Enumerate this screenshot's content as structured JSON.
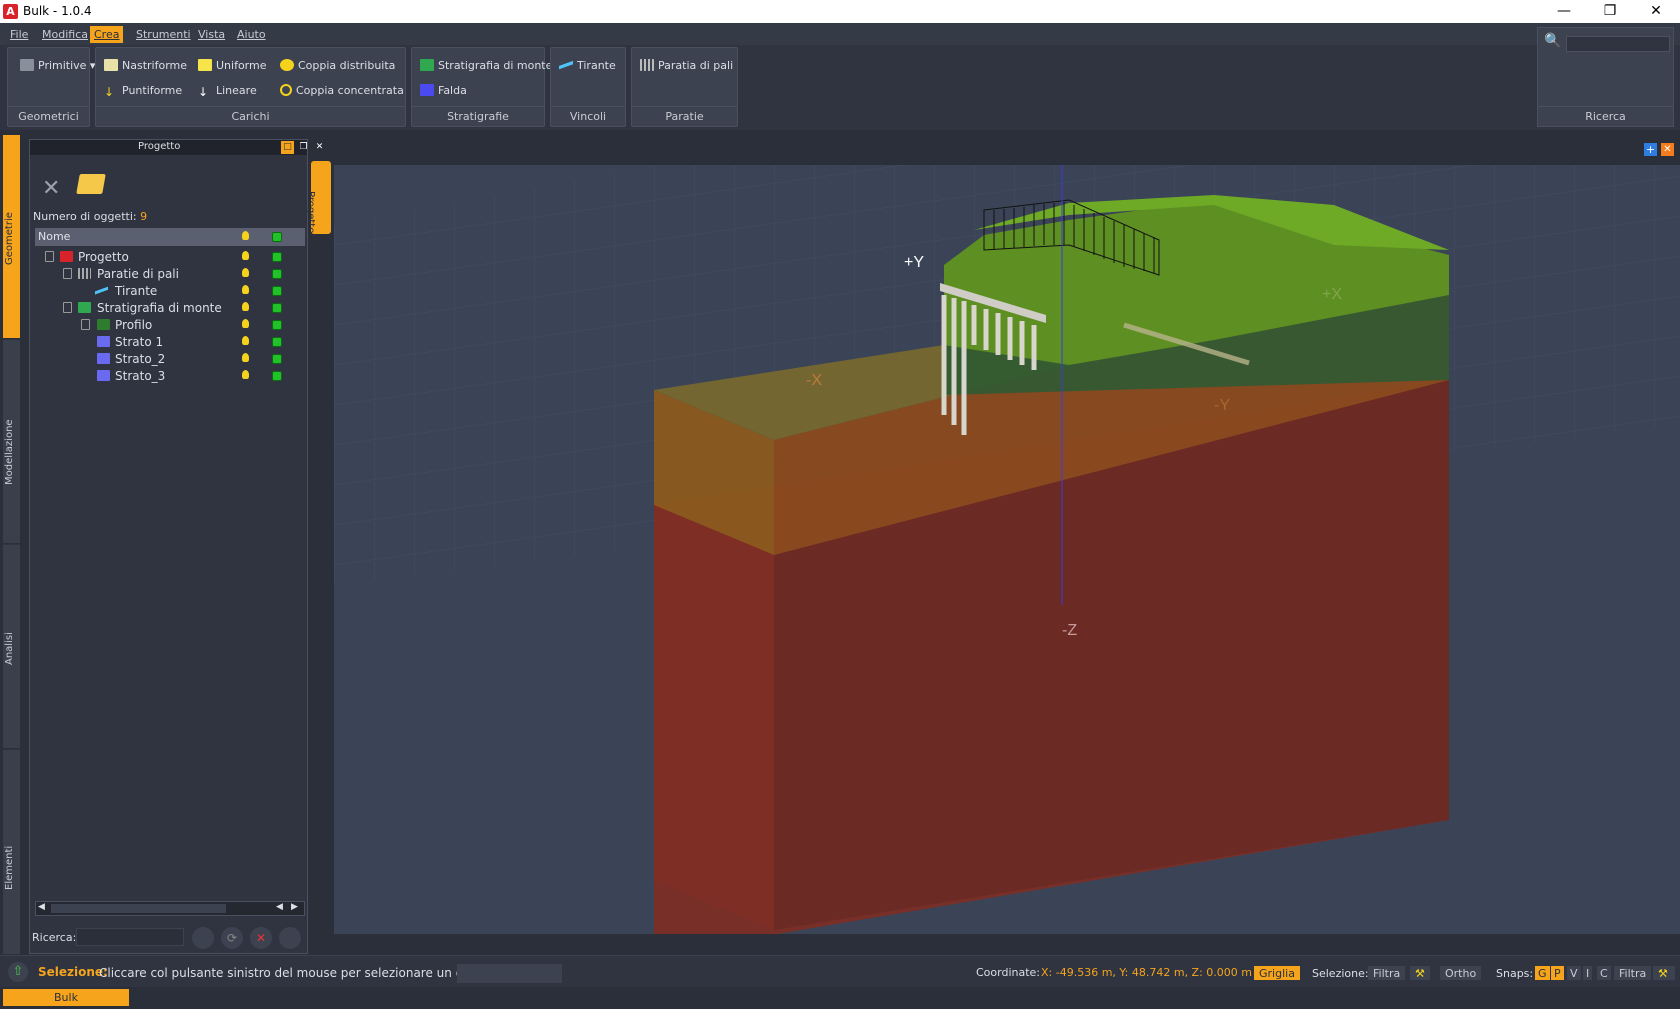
{
  "window": {
    "title": "Bulk - 1.0.4",
    "app_icon": "A"
  },
  "menu": [
    "File",
    "Modifica",
    "Crea",
    "Strumenti",
    "Vista",
    "Aiuto"
  ],
  "ribbon": {
    "geometrici": {
      "label": "Geometrici",
      "primitive": "Primitive"
    },
    "carichi": {
      "label": "Carichi",
      "nastriforme": "Nastriforme",
      "uniforme": "Uniforme",
      "coppia_distribuita": "Coppia distribuita",
      "puntiforme": "Puntiforme",
      "lineare": "Lineare",
      "coppia_concentrata": "Coppia concentrata"
    },
    "stratigrafie": {
      "label": "Stratigrafie",
      "monte": "Stratigrafia di monte",
      "falda": "Falda"
    },
    "vincoli": {
      "label": "Vincoli",
      "tirante": "Tirante"
    },
    "paratie": {
      "label": "Paratie",
      "paratia_pali": "Paratia di pali"
    },
    "ricerca": {
      "label": "Ricerca"
    }
  },
  "sidetabs": [
    "Geometrie",
    "Modellazione",
    "Analisi",
    "Elementi"
  ],
  "panel": {
    "title": "Progetto",
    "count_label": "Numero di oggetti:",
    "count": "9",
    "col_name": "Nome",
    "tree": [
      {
        "label": "Progetto",
        "color": "#d8232a"
      },
      {
        "label": "Paratie di pali",
        "color": "#aaaaaa"
      },
      {
        "label": "Tirante",
        "color": "#4fc3f7"
      },
      {
        "label": "Stratigrafia di monte",
        "color": "#2fa84f"
      },
      {
        "label": "Profilo",
        "color": "#2e9a2e"
      },
      {
        "label": "Strato 1",
        "color": "#6a6af0"
      },
      {
        "label": "Strato_2",
        "color": "#6a6af0"
      },
      {
        "label": "Strato_3",
        "color": "#6a6af0"
      }
    ],
    "search_label": "Ricerca:"
  },
  "viewport": {
    "tab": "Progetto",
    "axes": {
      "py": "+Y",
      "nx": "-X",
      "px": "+X",
      "ny": "-Y",
      "nz": "-Z"
    }
  },
  "status": {
    "sel_label": "Selezione:",
    "sel_msg": "Cliccare col pulsante sinistro del mouse per selezionare un oggetto",
    "coord_label": "Coordinate:",
    "coord": "X: -49.536 m, Y: 48.742 m, Z: 0.000 m",
    "griglia": "Griglia",
    "selezione": "Selezione:",
    "filtra": "Filtra",
    "ortho": "Ortho",
    "snaps": "Snaps:",
    "snap_g": "G",
    "snap_p": "P",
    "snap_v": "V",
    "snap_i": "I",
    "snap_c": "C",
    "filtra2": "Filtra"
  },
  "bottom_tab": "Bulk"
}
